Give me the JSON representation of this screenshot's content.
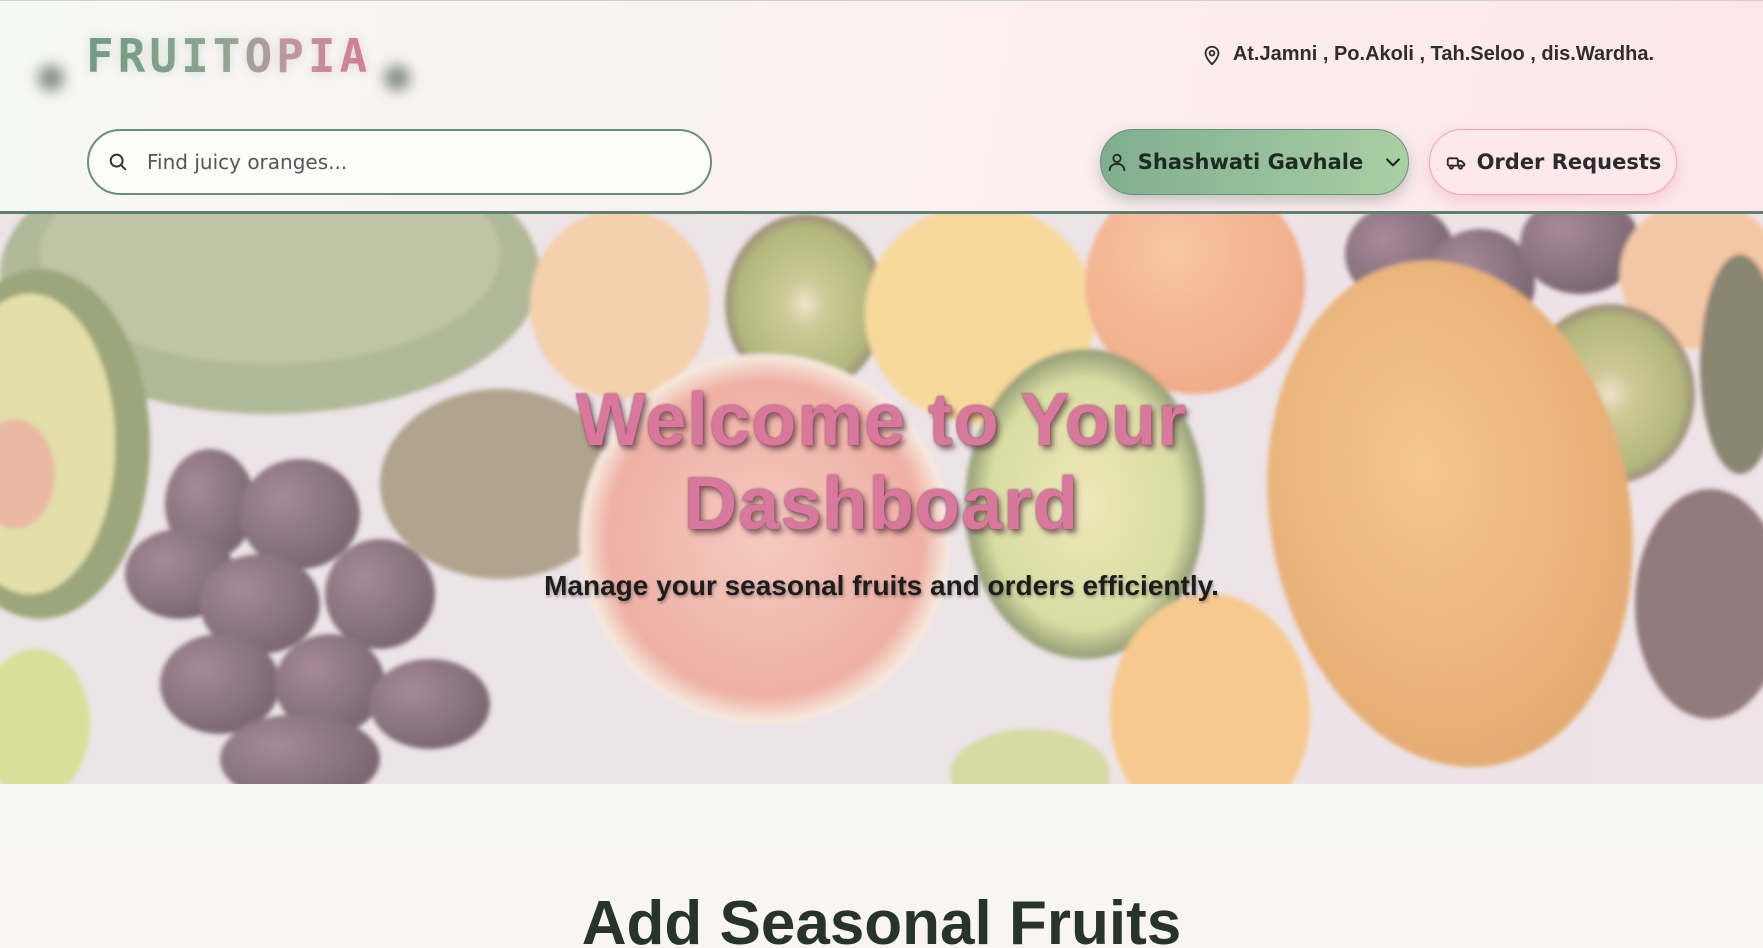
{
  "header": {
    "logo": "FRUITOPIA",
    "address": "At.Jamni , Po.Akoli , Tah.Seloo , dis.Wardha.",
    "address_icon": "map-pin-icon",
    "search": {
      "placeholder": "Find juicy oranges...",
      "icon": "search-icon"
    },
    "user_menu": {
      "label": "Shashwati Gavhale",
      "icon": "user-icon",
      "chevron": "chevron-down-icon"
    },
    "order_requests": {
      "label": "Order Requests",
      "icon": "truck-icon"
    }
  },
  "hero": {
    "title_line1": "Welcome to Your",
    "title_line2": "Dashboard",
    "subtitle": "Manage your seasonal fruits and orders efficiently."
  },
  "section": {
    "title": "Add Seasonal Fruits"
  },
  "colors": {
    "brand_green": "#7fae90",
    "brand_pink": "#d9779c",
    "divider": "#5f7f72"
  }
}
